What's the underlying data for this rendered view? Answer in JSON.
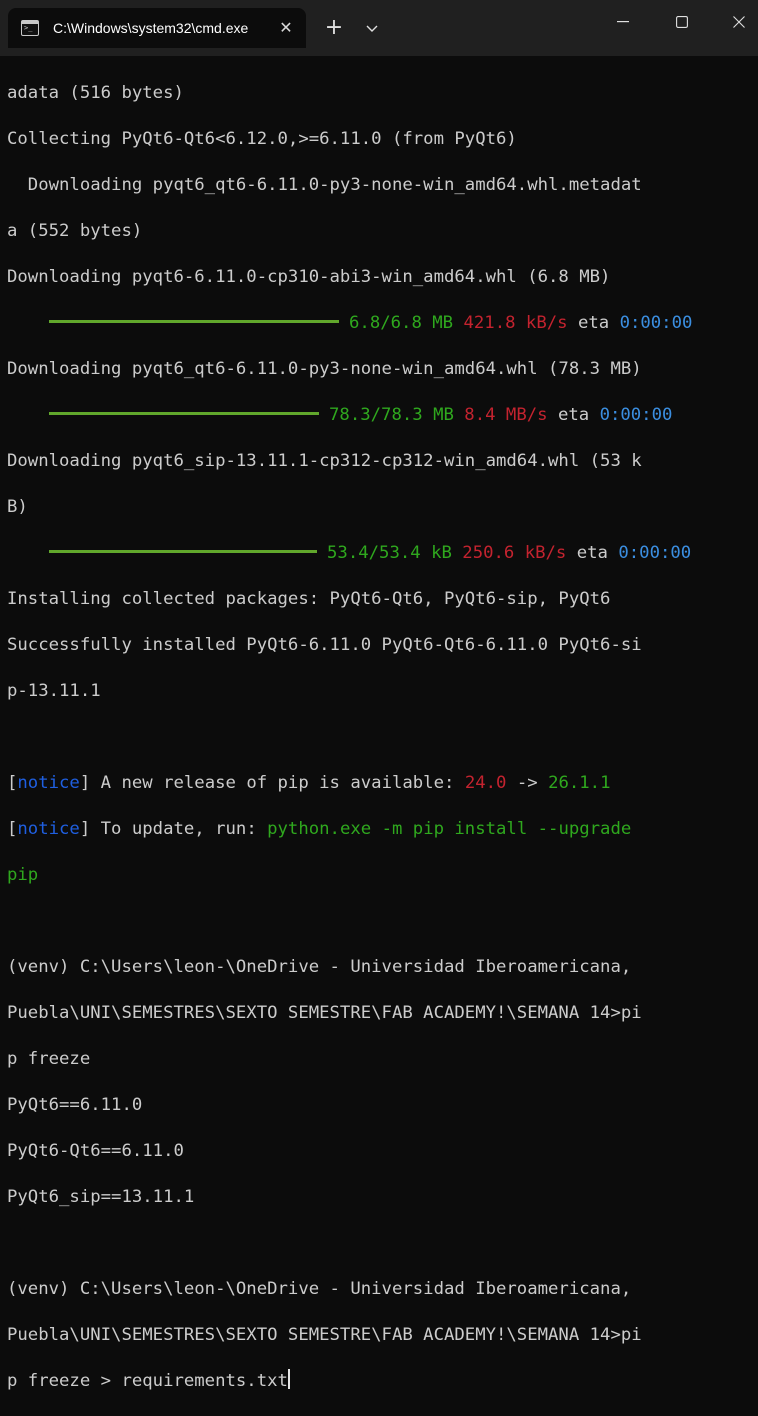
{
  "window": {
    "tab_title": "C:\\Windows\\system32\\cmd.exe",
    "new_tab": "+",
    "tab_close": "✕"
  },
  "terminal": {
    "l1": "adata (516 bytes)",
    "l2": "Collecting PyQt6-Qt6<6.12.0,>=6.11.0 (from PyQt6)",
    "l3": "  Downloading pyqt6_qt6-6.11.0-py3-none-win_amd64.whl.metadat",
    "l4": "a (552 bytes)",
    "l5": "Downloading pyqt6-6.11.0-cp310-abi3-win_amd64.whl (6.8 MB)",
    "p1": {
      "progress": 1.0,
      "size": "6.8/6.8 MB",
      "speed": "421.8 kB/s",
      "eta_label": "eta",
      "eta": "0:00:00"
    },
    "l7": "Downloading pyqt6_qt6-6.11.0-py3-none-win_amd64.whl (78.3 MB)",
    "p2": {
      "progress": 1.0,
      "size": "78.3/78.3 MB",
      "speed": "8.4 MB/s",
      "eta_label": "eta",
      "eta": "0:00:00"
    },
    "l9": "Downloading pyqt6_sip-13.11.1-cp312-cp312-win_amd64.whl (53 k",
    "l10": "B)",
    "p3": {
      "progress": 1.0,
      "size": "53.4/53.4 kB",
      "speed": "250.6 kB/s",
      "eta_label": "eta",
      "eta": "0:00:00"
    },
    "l12": "Installing collected packages: PyQt6-Qt6, PyQt6-sip, PyQt6",
    "l13": "Successfully installed PyQt6-6.11.0 PyQt6-Qt6-6.11.0 PyQt6-si",
    "l14": "p-13.11.1",
    "notice_word": "notice",
    "n1_text": " A new release of pip is available: ",
    "n1_old": "24.0",
    "n1_arrow": " -> ",
    "n1_new": "26.1.1",
    "n2_text": " To update, run: ",
    "n2_cmd": "python.exe -m pip install --upgrade",
    "n2_cmd2": "pip",
    "prompt1_a": "(venv) C:\\Users\\leon-\\OneDrive - Universidad Iberoamericana,",
    "prompt1_b": "Puebla\\UNI\\SEMESTRES\\SEXTO SEMESTRE\\FAB ACADEMY!\\SEMANA 14>pi",
    "prompt1_c": "p freeze",
    "out1": "PyQt6==6.11.0",
    "out2": "PyQt6-Qt6==6.11.0",
    "out3": "PyQt6_sip==13.11.1",
    "prompt2_a": "(venv) C:\\Users\\leon-\\OneDrive - Universidad Iberoamericana,",
    "prompt2_b": "Puebla\\UNI\\SEMESTRES\\SEXTO SEMESTRE\\FAB ACADEMY!\\SEMANA 14>pi",
    "prompt2_c": "p freeze > requirements.txt"
  },
  "colors": {
    "background": "#0c0c0c",
    "titlebar": "#202020",
    "progress_bar": "#61a72c",
    "green": "#2fa81e",
    "red": "#c4232f",
    "blue": "#3b8ee0"
  }
}
